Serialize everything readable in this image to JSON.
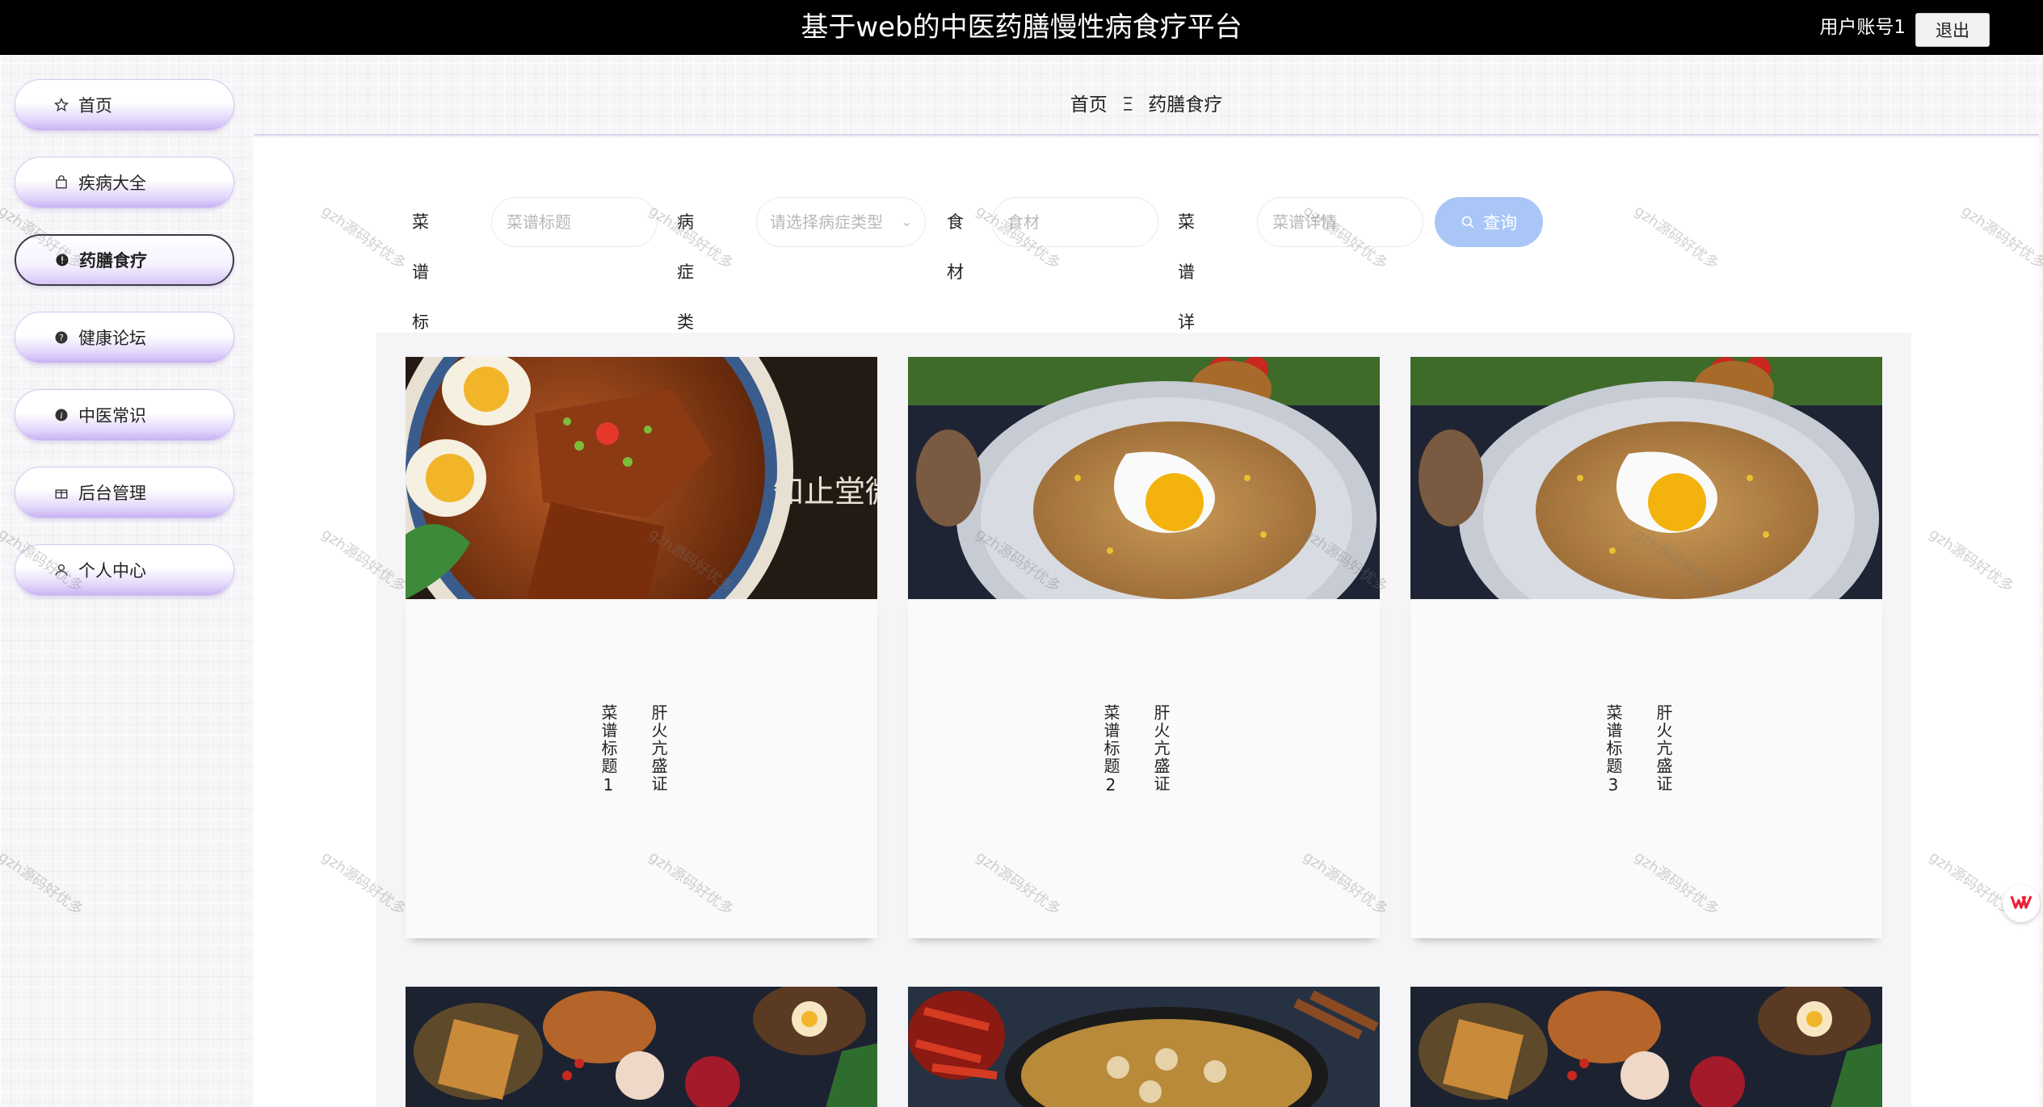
{
  "header": {
    "title": "基于web的中医药膳慢性病食疗平台",
    "account": "用户账号1",
    "logout_label": "退出"
  },
  "sidebar": {
    "items": [
      {
        "label": "首页",
        "icon": "star-icon"
      },
      {
        "label": "疾病大全",
        "icon": "bag-icon"
      },
      {
        "label": "药膳食疗",
        "icon": "alert-circle-icon",
        "active": true
      },
      {
        "label": "健康论坛",
        "icon": "question-circle-icon"
      },
      {
        "label": "中医常识",
        "icon": "info-circle-icon"
      },
      {
        "label": "后台管理",
        "icon": "gift-icon"
      },
      {
        "label": "个人中心",
        "icon": "user-icon"
      }
    ]
  },
  "breadcrumb": {
    "home": "首页",
    "separator": "Ξ",
    "current": "药膳食疗"
  },
  "search": {
    "title_label": "菜谱标题",
    "title_placeholder": "菜谱标题",
    "disease_label": "病症类型",
    "disease_placeholder": "请选择病症类型",
    "food_label": "食材",
    "food_placeholder": "食材",
    "detail_label": "菜谱详情",
    "detail_placeholder": "菜谱详情",
    "button_label": "查询"
  },
  "cards": [
    {
      "title": "菜谱标题1",
      "disease": "肝火亢盛证",
      "photo": "braised-duck-egg-photo"
    },
    {
      "title": "菜谱标题2",
      "disease": "肝火亢盛证",
      "photo": "fried-rice-egg-photo"
    },
    {
      "title": "菜谱标题3",
      "disease": "肝火亢盛证",
      "photo": "fried-rice-egg-photo"
    }
  ],
  "lower_cards": [
    {
      "photo": "feast-platter-photo"
    },
    {
      "photo": "seafood-clams-photo"
    },
    {
      "photo": "feast-platter-photo"
    }
  ],
  "watermark": "gzh源码好优多",
  "photo_overlay_text": "知止堂微信号",
  "colors": {
    "topbar": "#000000",
    "nav_gradient": "#c9b2f4",
    "search_button": "#a9c6f7"
  }
}
